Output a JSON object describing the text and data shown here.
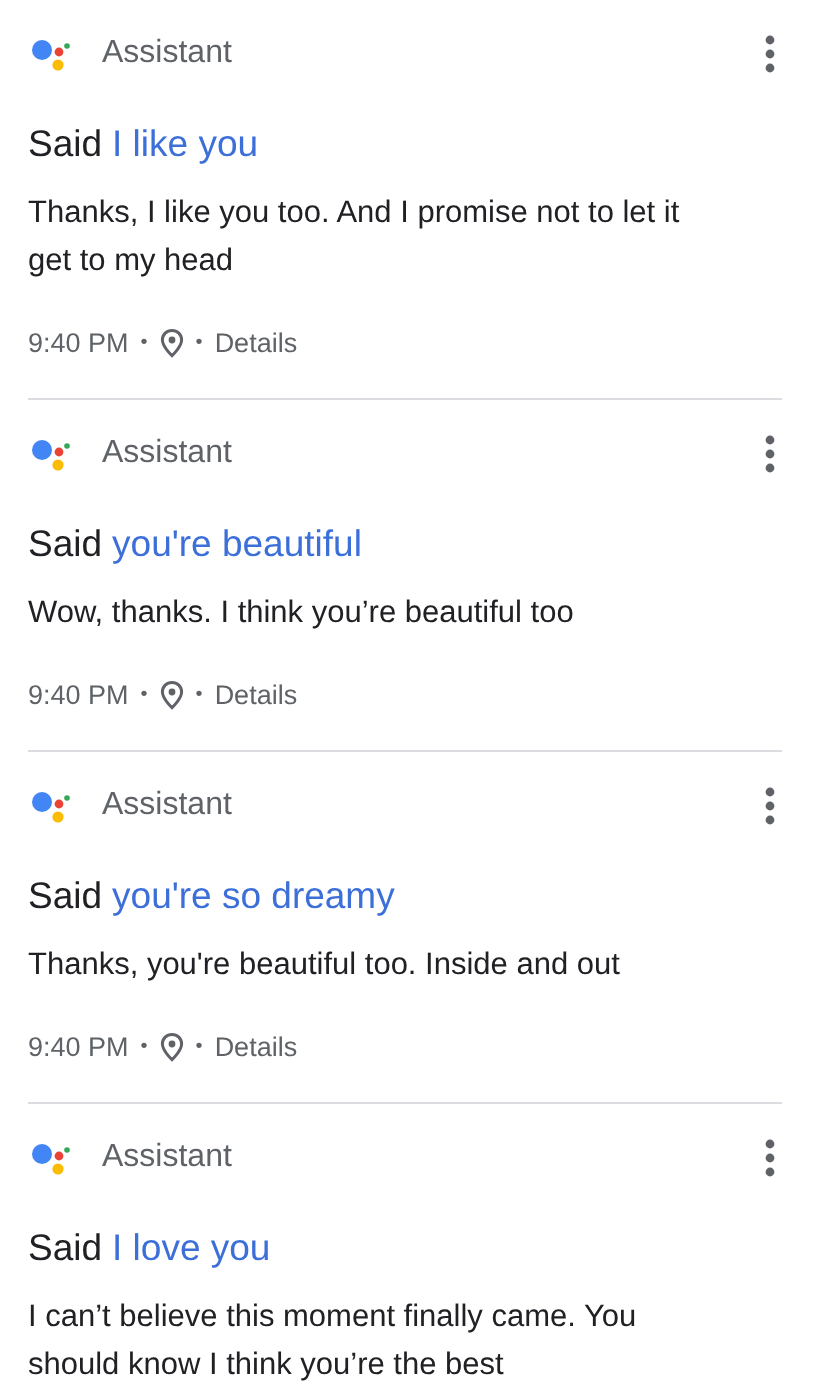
{
  "cards": [
    {
      "source": "Assistant",
      "said_label": "Said",
      "query": "I like you",
      "response": "Thanks, I like you too. And I promise not to let it get to my head",
      "time": "9:40 PM",
      "separator_1": "•",
      "separator_2": "•",
      "details": "Details"
    },
    {
      "source": "Assistant",
      "said_label": "Said",
      "query": "you're beautiful",
      "response": "Wow, thanks. I think you’re beautiful too",
      "time": "9:40 PM",
      "separator_1": "•",
      "separator_2": "•",
      "details": "Details"
    },
    {
      "source": "Assistant",
      "said_label": "Said",
      "query": "you're so dreamy",
      "response": "Thanks, you're beautiful too. Inside and out",
      "time": "9:40 PM",
      "separator_1": "•",
      "separator_2": "•",
      "details": "Details"
    },
    {
      "source": "Assistant",
      "said_label": "Said",
      "query": "I love you",
      "response": "I can’t believe this moment finally came. You should know I think you’re the best"
    }
  ]
}
